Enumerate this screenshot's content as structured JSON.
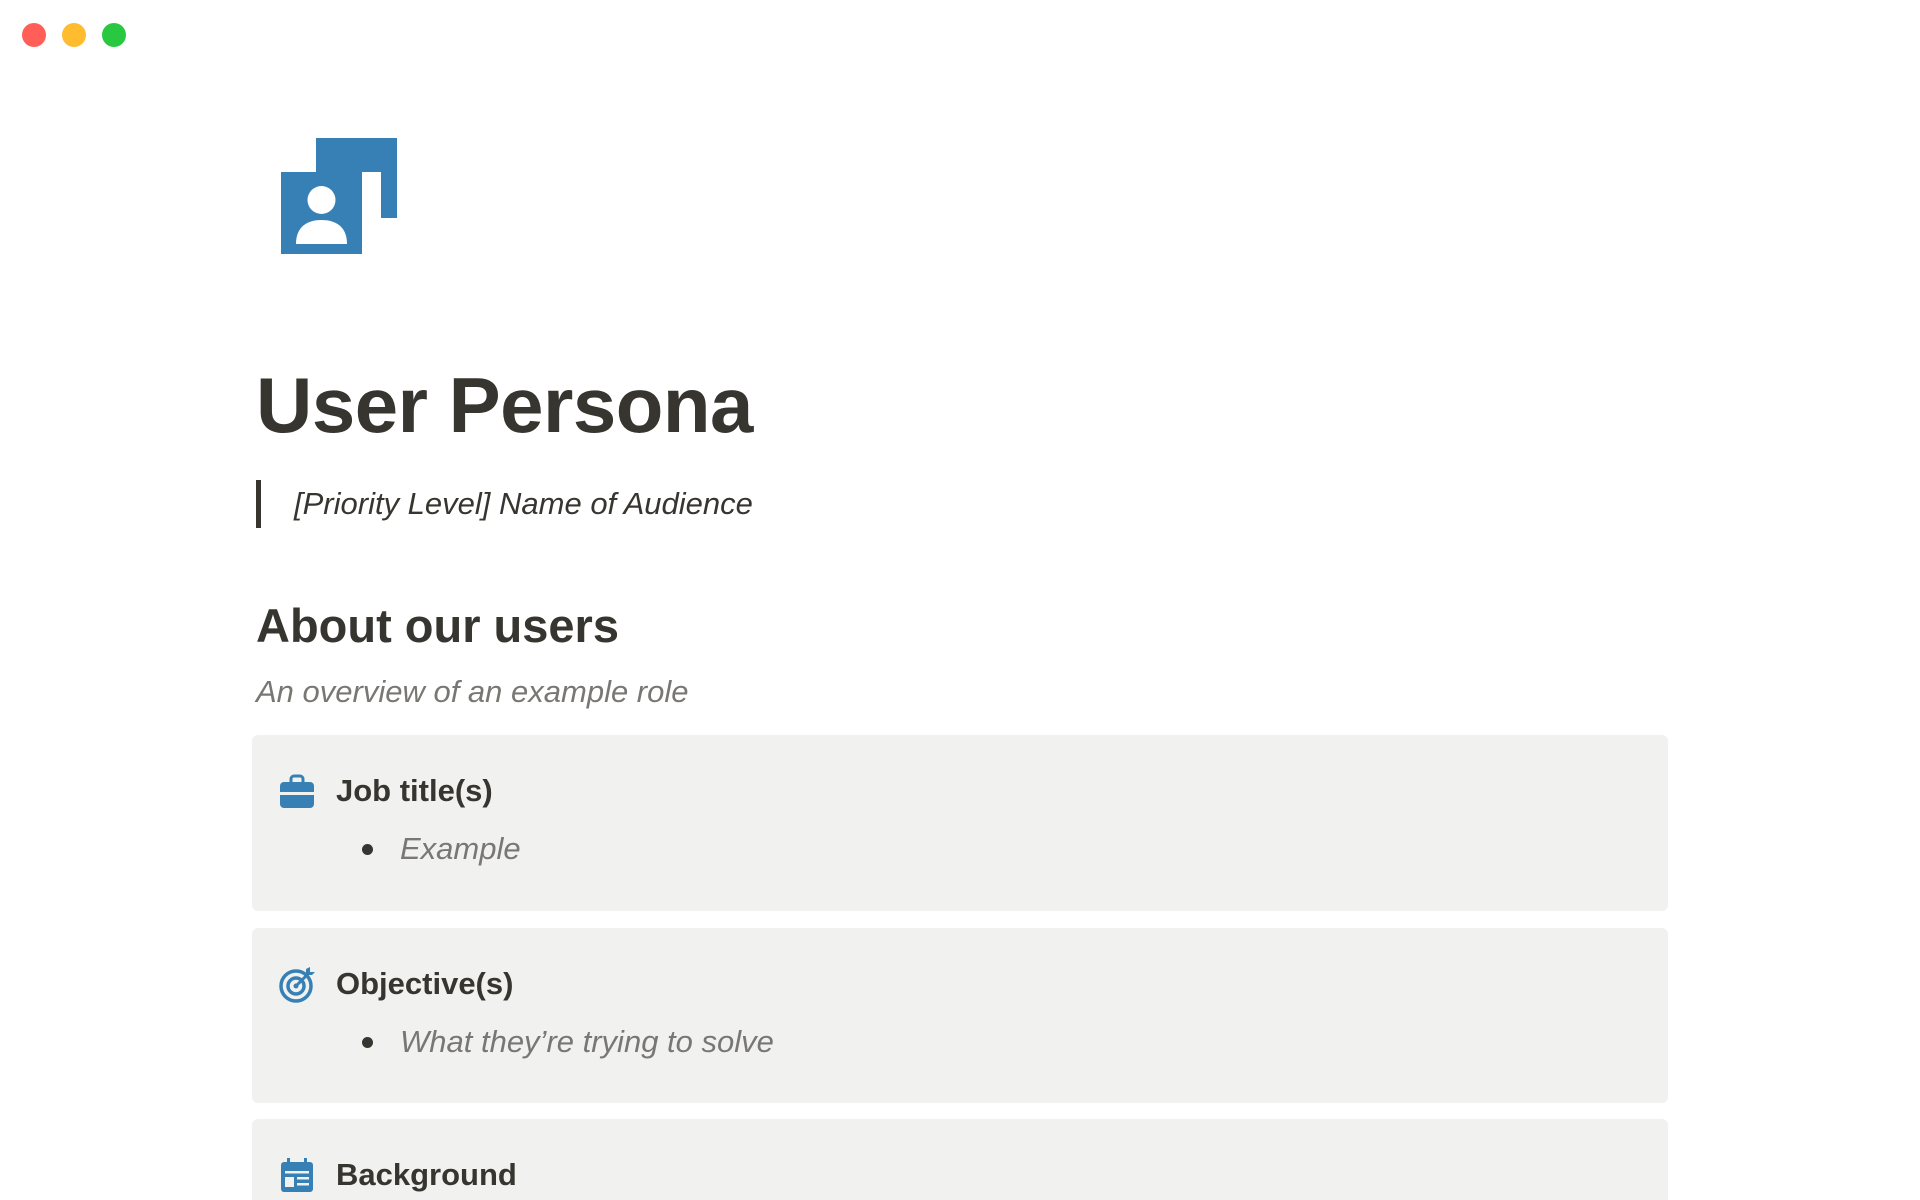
{
  "window": {
    "controls": {
      "close_color": "#ff5f57",
      "minimize_color": "#febc2e",
      "maximize_color": "#28c840"
    }
  },
  "page": {
    "icon": "user-persona-icon",
    "icon_color": "#3780b5",
    "title": "User Persona",
    "quote": "[Priority Level] Name of Audience"
  },
  "section": {
    "heading": "About our users",
    "subtitle": "An overview of an example role"
  },
  "callouts": [
    {
      "icon": "briefcase-icon",
      "title": "Job title(s)",
      "bullets": [
        "Example"
      ]
    },
    {
      "icon": "target-icon",
      "title": "Objective(s)",
      "bullets": [
        "What they’re trying to solve"
      ]
    },
    {
      "icon": "calendar-icon",
      "title": "Background",
      "bullets": []
    }
  ],
  "colors": {
    "text": "#37352f",
    "muted_text": "#787774",
    "callout_background": "#f1f1ef",
    "accent_blue": "#3780b5"
  }
}
